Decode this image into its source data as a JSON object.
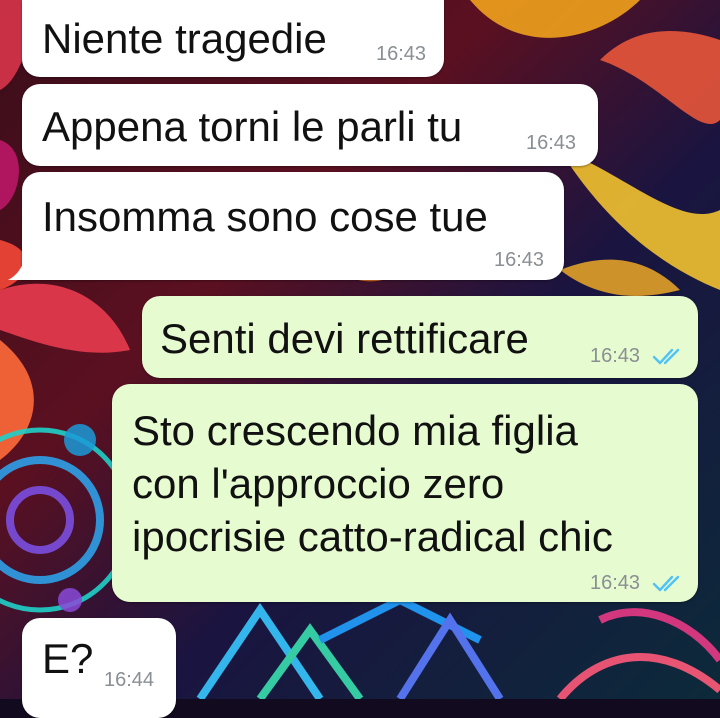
{
  "colors": {
    "incoming_bubble": "#ffffff",
    "outgoing_bubble": "#e6fbd0",
    "text": "#111111",
    "timestamp": "#8a8f93",
    "read_ticks": "#4fc3f7"
  },
  "messages": [
    {
      "direction": "incoming",
      "text": "Niente tragedie",
      "time": "16:43"
    },
    {
      "direction": "incoming",
      "text": "Appena torni le parli tu",
      "time": "16:43"
    },
    {
      "direction": "incoming",
      "text": "Insomma sono cose tue",
      "time": "16:43"
    },
    {
      "direction": "outgoing",
      "text": "Senti devi rettificare",
      "time": "16:43",
      "status_icon": "double-check-icon"
    },
    {
      "direction": "outgoing",
      "text": "Sto crescendo mia figlia\ncon l'approccio zero\nipocrisie catto-radical chic",
      "time": "16:43",
      "status_icon": "double-check-icon"
    },
    {
      "direction": "incoming",
      "text": "E?",
      "time": "16:44"
    }
  ]
}
